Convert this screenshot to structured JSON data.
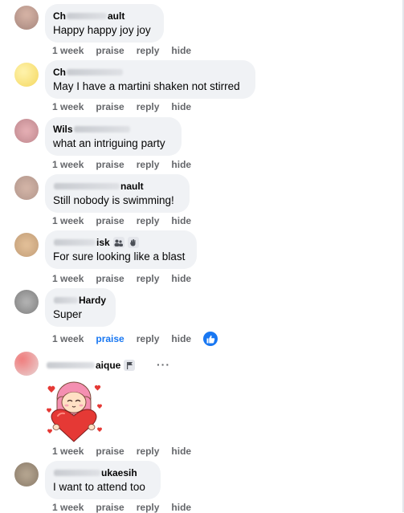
{
  "comments": [
    {
      "name_pre": "Ch",
      "name_post": "ault",
      "text": "Happy happy joy joy",
      "time": "1 week",
      "praise": "praise",
      "reply": "reply",
      "hide": "hide"
    },
    {
      "name_pre": "Ch",
      "name_post": "",
      "text": "May I have a martini shaken not stirred",
      "time": "1 week",
      "praise": "praise",
      "reply": "reply",
      "hide": "hide"
    },
    {
      "name_pre": "Wils",
      "name_post": "",
      "text": "what an intriguing party",
      "time": "1 week",
      "praise": "praise",
      "reply": "reply",
      "hide": "hide"
    },
    {
      "name_pre": "",
      "name_post": "nault",
      "text": "Still nobody is swimming!",
      "time": "1 week",
      "praise": "praise",
      "reply": "reply",
      "hide": "hide"
    },
    {
      "name_pre": "",
      "name_post": "isk",
      "text": "For sure looking like a blast",
      "time": "1 week",
      "praise": "praise",
      "reply": "reply",
      "hide": "hide"
    },
    {
      "name_pre": "",
      "name_post": "Hardy",
      "text": "Super",
      "time": "1 week",
      "praise": "praise",
      "reply": "reply",
      "hide": "hide"
    },
    {
      "name_pre": "",
      "name_post": "aique",
      "text": "",
      "time": "1 week",
      "praise": "praise",
      "reply": "reply",
      "hide": "hide",
      "menu": "···"
    },
    {
      "name_pre": "",
      "name_post": "ukaesih",
      "text": "I want to attend too",
      "time": "1 week",
      "praise": "praise",
      "reply": "reply",
      "hide": "hide"
    }
  ],
  "icons": {
    "like": "like-icon",
    "group_badge": "people-icon",
    "flag_badge": "flag-icon",
    "sticker": "heart-girl-sticker"
  },
  "colors": {
    "bubble": "#f0f2f5",
    "meta": "#65676b",
    "accent": "#1877f2"
  }
}
